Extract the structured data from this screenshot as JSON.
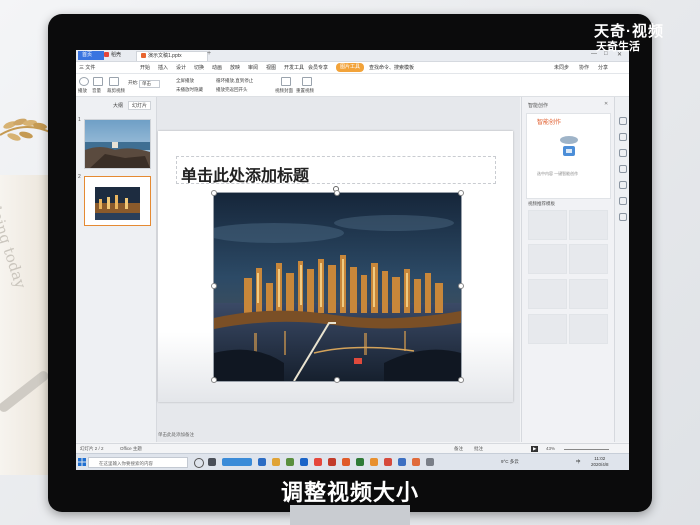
{
  "watermark": {
    "brand": "天奇·视频",
    "sub": "天奇生活"
  },
  "caption": "调整视频大小",
  "decor": {
    "notebook_text": "doing today"
  },
  "app": {
    "tabs": [
      {
        "label": "首页"
      },
      {
        "label": "稻壳"
      },
      {
        "label": "演示文稿1.pptx"
      }
    ],
    "add_tab": "+",
    "menu": [
      "三 文件",
      "开始",
      "插入",
      "设计",
      "切换",
      "动画",
      "放映",
      "审阅",
      "视图",
      "开发工具",
      "会员专享",
      "图片工具",
      "查找命令、搜索模板"
    ],
    "menu_active": "图片工具",
    "top_right": [
      "未同步",
      "协作",
      "分享"
    ],
    "ribbon": [
      {
        "label": "播放"
      },
      {
        "label": "音量"
      },
      {
        "label": "裁剪视频"
      },
      {
        "label": "开始:"
      },
      {
        "label": "单击"
      },
      {
        "label": "全屏播放"
      },
      {
        "label": "未播放时隐藏"
      },
      {
        "label": "循环播放,直到停止"
      },
      {
        "label": "播放完返回开头"
      },
      {
        "label": "视频封面"
      },
      {
        "label": "重置视频"
      }
    ]
  },
  "left_pane": {
    "tabs": [
      "大纲",
      "幻灯片"
    ],
    "slides": [
      {
        "num": "1"
      },
      {
        "num": "2"
      }
    ],
    "add_button": "+"
  },
  "slide": {
    "title_placeholder": "单击此处添加标题",
    "notes_placeholder": "单击此处添加备注"
  },
  "right_pane": {
    "header": "智能创作",
    "card_title": "智能创作",
    "card_note": "选中内容 一键智能创作",
    "section": "视频推荐模板"
  },
  "status_bar": {
    "slide_info": "幻灯片 2 / 2",
    "theme": "Office 主题",
    "right": [
      "备注",
      "批注"
    ],
    "zoom": "43%"
  },
  "taskbar": {
    "search_placeholder": "在这里输入你要搜索的内容",
    "weather": "9°C 多云",
    "lang": "中",
    "time": "11:02",
    "date": "2020/4/8"
  },
  "colors": {
    "accent": "#3a74e0",
    "picture_tools": "#f2a33a",
    "smart_title": "#e05b2a"
  }
}
